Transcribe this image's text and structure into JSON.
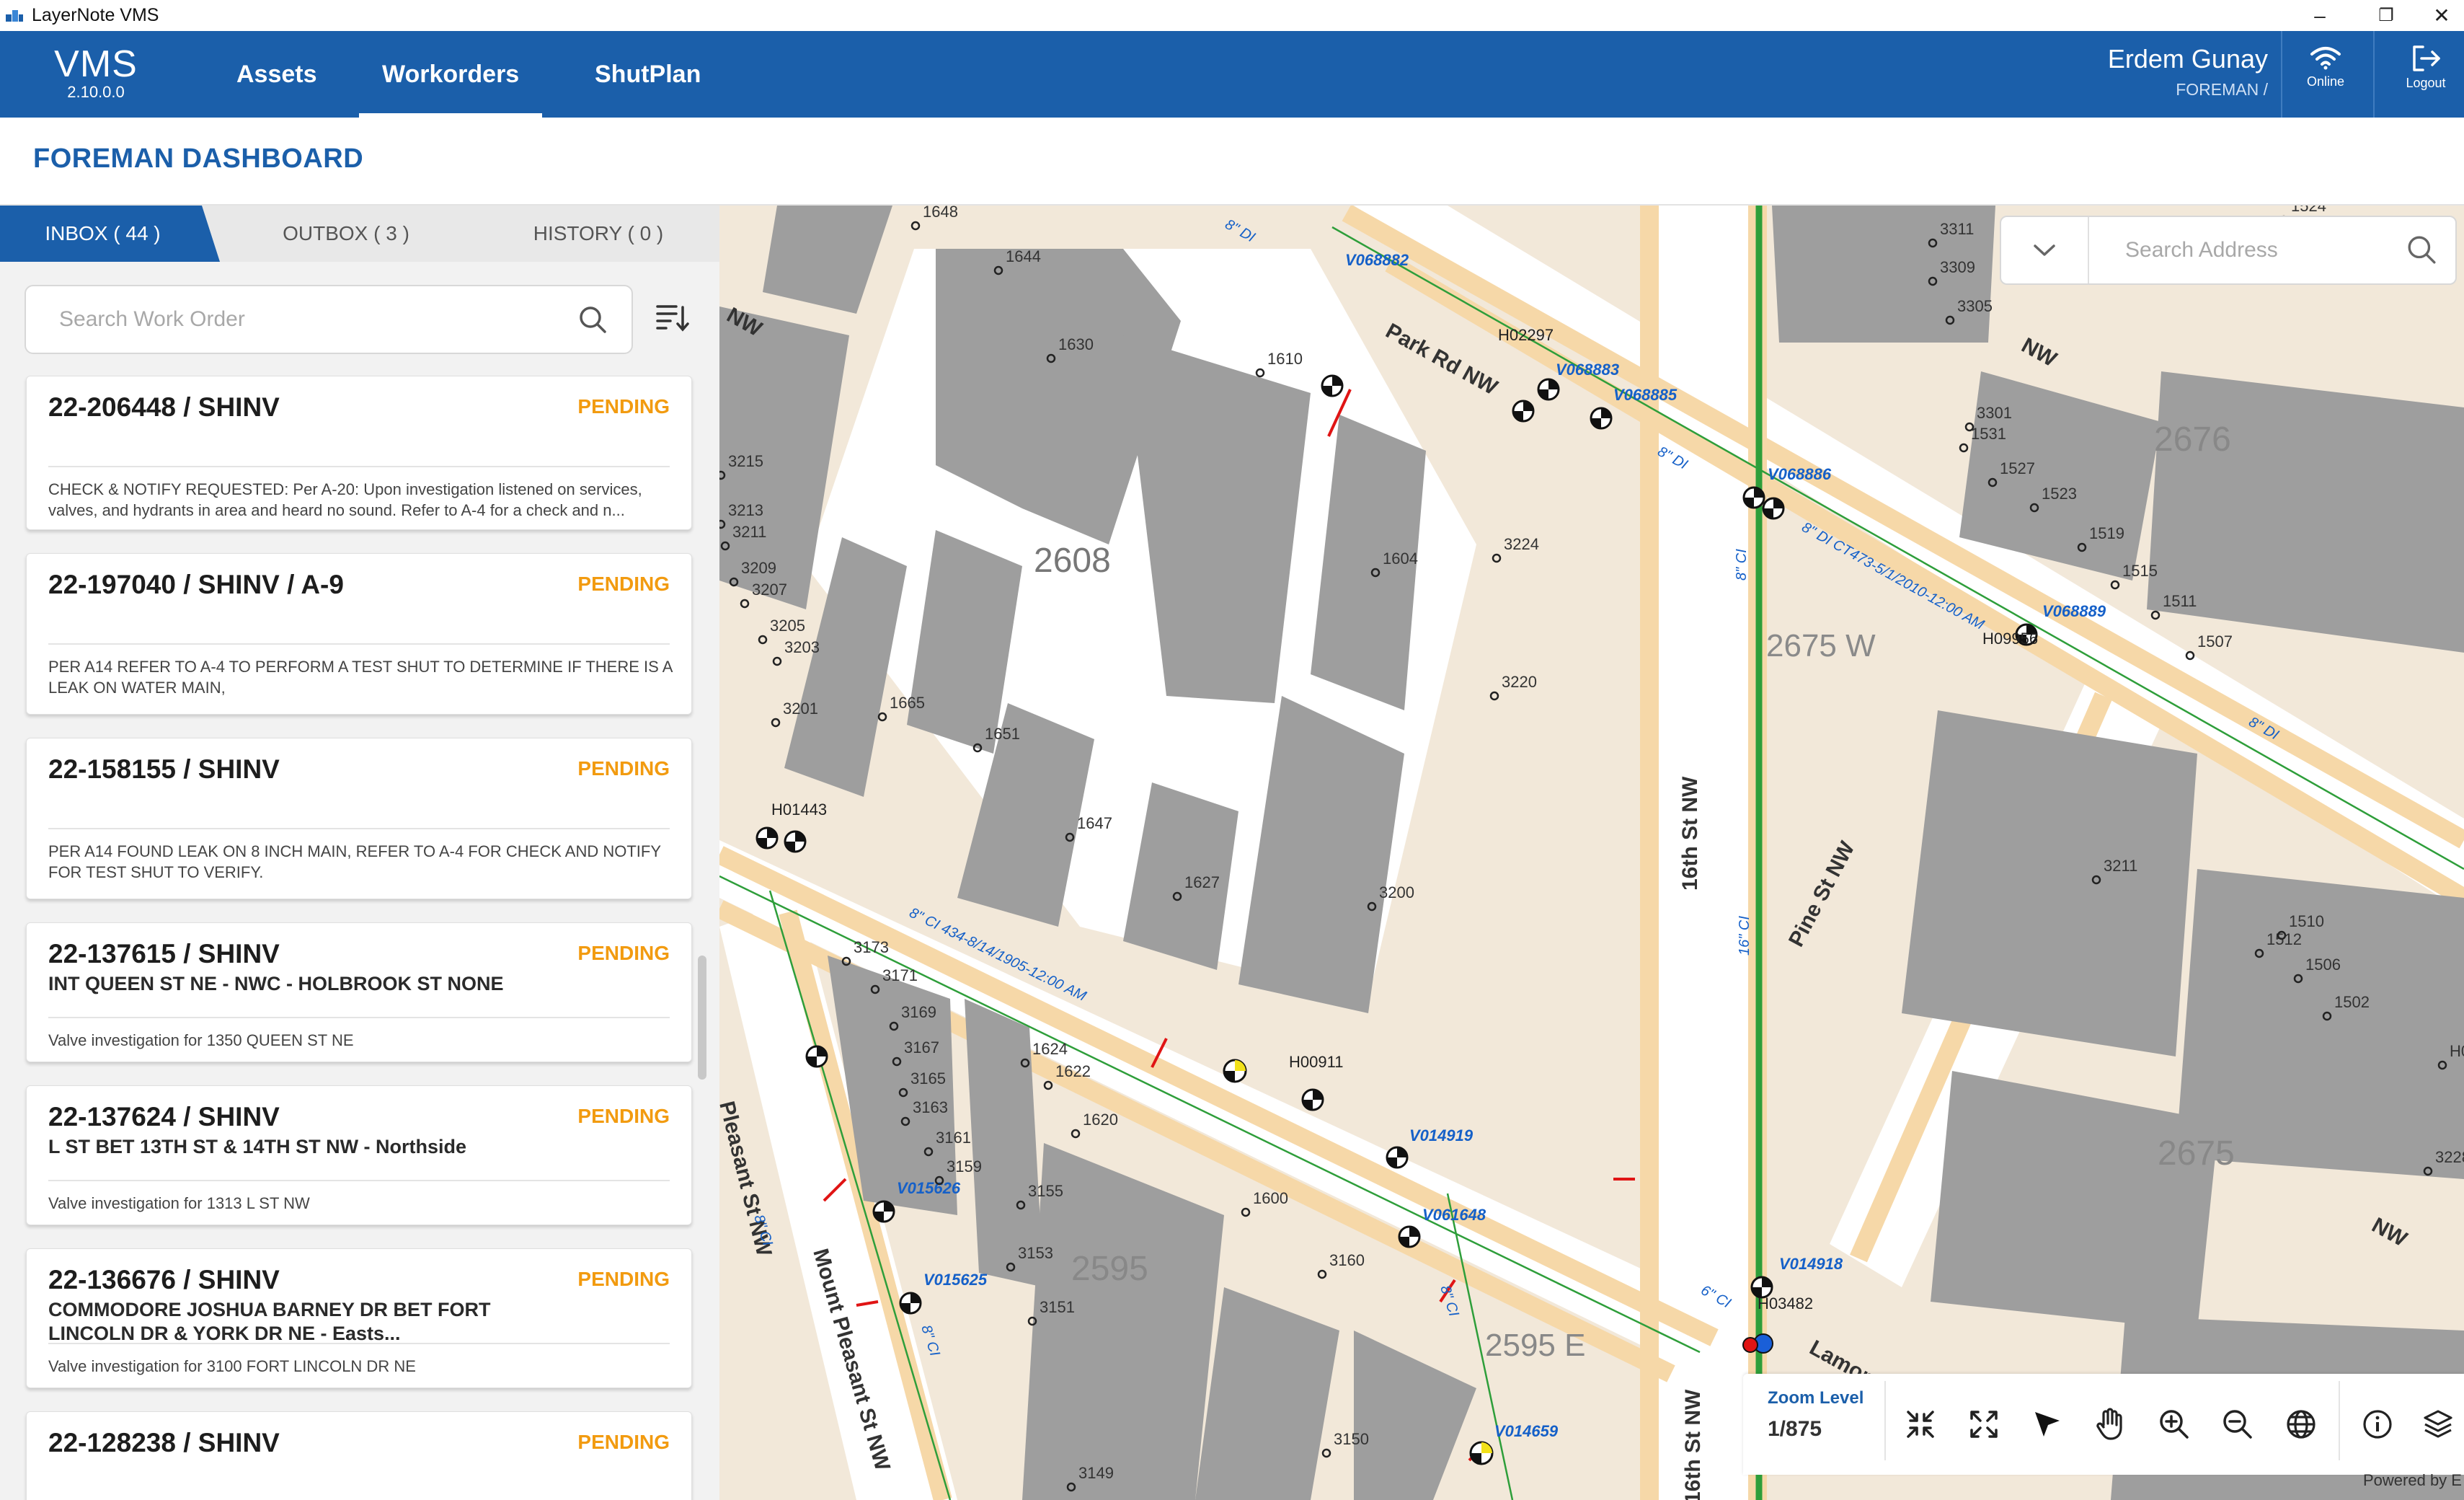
{
  "window": {
    "title": "LayerNote VMS",
    "minimize": "–",
    "restore": "❐",
    "close": "✕"
  },
  "header": {
    "logo_name": "VMS",
    "logo_version": "2.10.0.0",
    "nav": [
      "Assets",
      "Workorders",
      "ShutPlan"
    ],
    "active_nav": "Workorders",
    "user_name": "Erdem Gunay",
    "user_role": "FOREMAN /",
    "online_label": "Online",
    "logout_label": "Logout",
    "bar_color": "#1b5faa"
  },
  "page": {
    "title": "FOREMAN DASHBOARD"
  },
  "tabs": [
    "INBOX ( 44 )",
    "OUTBOX ( 3 )",
    "HISTORY ( 0 )"
  ],
  "search": {
    "placeholder": "Search Work Order",
    "value": ""
  },
  "work_orders": [
    {
      "id": "22-206448 / SHINV",
      "status": "PENDING",
      "address": "",
      "description": "CHECK & NOTIFY REQUESTED: Per A-20: Upon investigation listened on services, valves, and hydrants in area and heard no sound. Refer to A-4 for a check and n..."
    },
    {
      "id": "22-197040 / SHINV / A-9",
      "status": "PENDING",
      "address": "",
      "description": "PER A14 REFER TO A-4 TO PERFORM A TEST SHUT TO DETERMINE IF THERE IS A LEAK ON WATER MAIN,"
    },
    {
      "id": "22-158155 / SHINV",
      "status": "PENDING",
      "address": "",
      "description": "PER A14 FOUND LEAK ON 8 INCH MAIN, REFER TO A-4 FOR CHECK AND NOTIFY FOR TEST SHUT TO VERIFY."
    },
    {
      "id": "22-137615 / SHINV",
      "status": "PENDING",
      "address": "INT QUEEN ST NE - NWC - HOLBROOK ST NONE",
      "description": "Valve investigation for 1350 QUEEN ST NE"
    },
    {
      "id": "22-137624 / SHINV",
      "status": "PENDING",
      "address": "L ST BET 13TH ST & 14TH ST NW - Northside",
      "description": "Valve investigation for 1313 L ST NW"
    },
    {
      "id": "22-136676 / SHINV",
      "status": "PENDING",
      "address": "COMMODORE JOSHUA BARNEY DR BET FORT LINCOLN DR & YORK DR NE - Easts...",
      "description": "Valve investigation for 3100 FORT LINCOLN DR NE"
    },
    {
      "id": "22-128238 / SHINV",
      "status": "PENDING",
      "address": "",
      "description": ""
    }
  ],
  "map": {
    "address_search_placeholder": "Search Address",
    "zoom_label": "Zoom Level",
    "zoom_value": "1/875",
    "powered_by": "Powered by E",
    "streets": [
      "Park Rd NW",
      "16th St NW",
      "Pine St NW",
      "Mount Pleasant St NW",
      "Pleasant St NW",
      "Lamont",
      "NW"
    ],
    "block_ids": [
      "2608",
      "2676",
      "2675",
      "2595",
      "2595 E",
      "2675 W"
    ],
    "asset_ids": [
      "V068882",
      "H02297",
      "V068883",
      "V068885",
      "V068886",
      "V068889",
      "H09956",
      "H01443",
      "H00911",
      "V014919",
      "V061648",
      "V015626",
      "V015625",
      "V014918",
      "H03482",
      "V014659"
    ],
    "pipe_labels": [
      "8\" DI",
      "8\" DI",
      "8\" DI CT473-5/1/2010-12:00 AM",
      "8\" DI",
      "8\" CI 434-8/14/1905-12:00 AM",
      "16\" CI",
      "8\" CI",
      "6\" CI",
      "8\" CI",
      "8\" CI",
      "8\" CI"
    ],
    "house_numbers": [
      "1648",
      "1644",
      "1630",
      "1610",
      "3215",
      "3213",
      "3211",
      "3209",
      "3207",
      "3205",
      "3203",
      "3201",
      "1665",
      "1651",
      "1604",
      "3224",
      "3220",
      "1647",
      "1627",
      "3200",
      "3311",
      "3309",
      "3305",
      "3301",
      "1531",
      "1527",
      "1523",
      "1519",
      "1515",
      "1511",
      "1507",
      "3211",
      "1512",
      "1510",
      "1506",
      "1502",
      "3228",
      "3173",
      "3171",
      "3169",
      "3167",
      "3165",
      "3163",
      "3161",
      "3159",
      "3155",
      "1624",
      "1622",
      "1620",
      "1600",
      "3153",
      "3151",
      "3160",
      "3150",
      "3149",
      "1524",
      "H0"
    ],
    "colors": {
      "building": "#9e9e9e",
      "ground": "#f2e8d9",
      "sidewalk": "#f6d8a8",
      "water_line": "#2e9e3a",
      "label": "#1560c8",
      "valve_red": "#e01414"
    }
  },
  "toolbar_icons": [
    "collapse-icon",
    "fullscreen-icon",
    "select-arrow-icon",
    "pan-hand-icon",
    "zoom-in-icon",
    "zoom-out-icon",
    "globe-icon",
    "info-icon",
    "layers-icon"
  ]
}
